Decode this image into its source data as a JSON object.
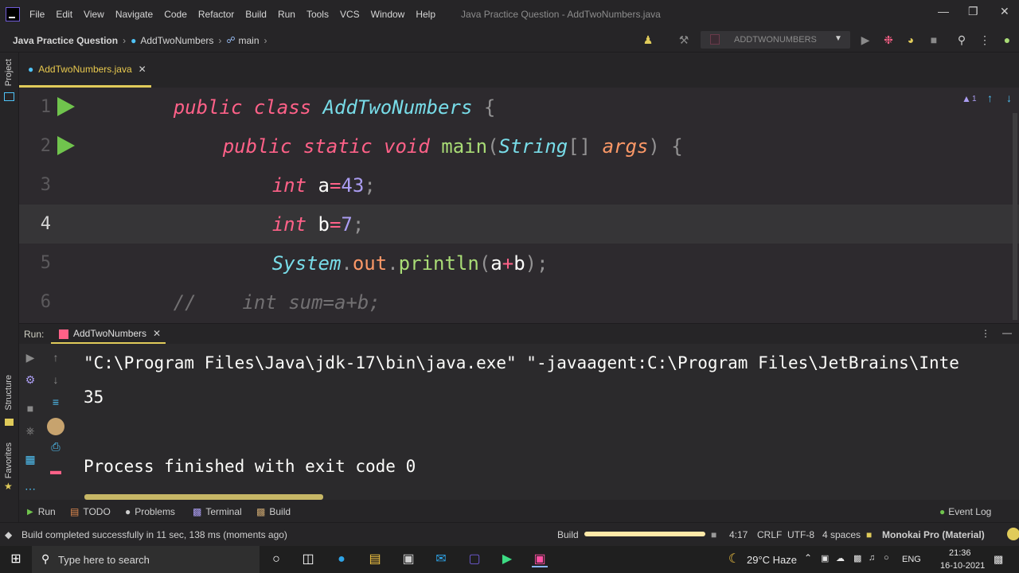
{
  "menubar": {
    "items": [
      "File",
      "Edit",
      "View",
      "Navigate",
      "Code",
      "Refactor",
      "Build",
      "Run",
      "Tools",
      "VCS",
      "Window",
      "Help"
    ],
    "window_title": "Java Practice Question - AddTwoNumbers.java"
  },
  "navbar": {
    "project": "Java Practice Question",
    "class_crumb": "AddTwoNumbers",
    "method_crumb": "main",
    "run_config": "ADDTWONUMBERS"
  },
  "side": {
    "project": "Project",
    "structure": "Structure",
    "favorites": "Favorites"
  },
  "editor": {
    "tab_label": "AddTwoNumbers.java",
    "inspection_count": "1",
    "lines": [
      {
        "num": "1"
      },
      {
        "num": "2"
      },
      {
        "num": "3"
      },
      {
        "num": "4"
      },
      {
        "num": "5"
      },
      {
        "num": "6"
      }
    ],
    "tokens": {
      "l1_public": "public",
      "l1_class": "class",
      "l1_name": "AddTwoNumbers",
      "l1_brace": "{",
      "l2_public": "public",
      "l2_static": "static",
      "l2_void": "void",
      "l2_main": "main",
      "l2_lp": "(",
      "l2_string": "String",
      "l2_arr": "[]",
      "l2_args": "args",
      "l2_rp": ")",
      "l2_brace": "{",
      "l3_int": "int",
      "l3_a": "a",
      "l3_eq": "=",
      "l3_val": "43",
      "l3_semi": ";",
      "l4_int": "int",
      "l4_b": "b",
      "l4_eq": "=",
      "l4_val": "7",
      "l4_semi": ";",
      "l5_system": "System",
      "l5_dot1": ".",
      "l5_out": "out",
      "l5_dot2": ".",
      "l5_println": "println",
      "l5_lp": "(",
      "l5_a": "a",
      "l5_plus": "+",
      "l5_b": "b",
      "l5_rp": ")",
      "l5_semi": ";",
      "l6_comment": "//",
      "l6_text": "int sum=a+b;"
    }
  },
  "run_panel": {
    "label": "Run:",
    "tab_label": "AddTwoNumbers",
    "console_lines": [
      "\"C:\\Program Files\\Java\\jdk-17\\bin\\java.exe\" \"-javaagent:C:\\Program Files\\JetBrains\\Inte",
      "35",
      "Process finished with exit code 0"
    ]
  },
  "bottom_tabs": {
    "run": "Run",
    "todo": "TODO",
    "problems": "Problems",
    "terminal": "Terminal",
    "build": "Build",
    "event_log": "Event Log"
  },
  "statusbar": {
    "message": "Build completed successfully in 11 sec, 138 ms (moments ago)",
    "build_label": "Build",
    "position": "4:17",
    "line_sep": "CRLF",
    "encoding": "UTF-8",
    "indent": "4 spaces",
    "theme": "Monokai Pro (Material)"
  },
  "taskbar": {
    "search_placeholder": "Type here to search",
    "weather": "29°C  Haze",
    "lang": "ENG",
    "time": "21:36",
    "date": "16-10-2021"
  },
  "colors": {
    "keyword": "#ff6188",
    "type": "#78dce8",
    "function": "#a9dc76",
    "number": "#ab9df2",
    "param": "#fc9867",
    "accent_tab": "#e0cb5a",
    "run_green": "#70c44d"
  }
}
